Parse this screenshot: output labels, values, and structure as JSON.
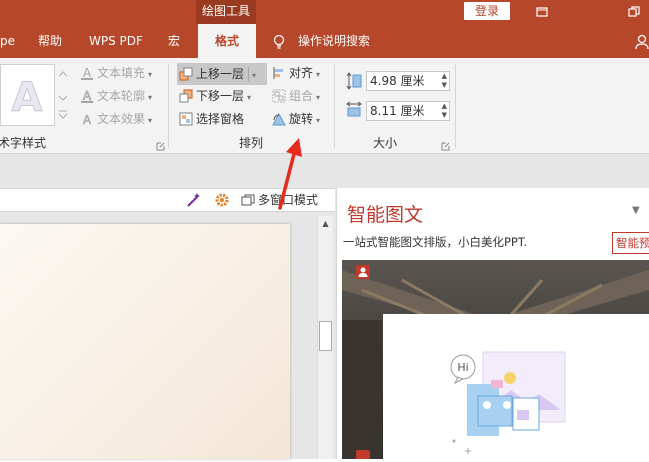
{
  "titlebar": {
    "context_label": "绘图工具",
    "login_label": "登录",
    "restore_icon": "restore-window-icon",
    "maximize_icon": "maximize-window-icon"
  },
  "tabs": [
    {
      "label": "pe"
    },
    {
      "label": "帮助"
    },
    {
      "label": "WPS PDF"
    },
    {
      "label": "宏"
    },
    {
      "label": "格式",
      "active": true
    },
    {
      "label": "操作说明搜索"
    }
  ],
  "ribbon": {
    "art_group": {
      "label": "艺术字样式",
      "fill": "文本填充",
      "outline": "文本轮廓",
      "effect": "文本效果"
    },
    "arrange_group": {
      "label": "排列",
      "bring_forward": "上移一层",
      "send_backward": "下移一层",
      "selection_pane": "选择窗格",
      "align": "对齐",
      "group": "组合",
      "rotate": "旋转"
    },
    "size_group": {
      "label": "大小",
      "height": "4.98 厘米",
      "width": "8.11 厘米"
    }
  },
  "workspace": {
    "multi_window": "多窗口模式"
  },
  "smart_pane": {
    "title": "智能图文",
    "subtitle": "一站式智能图文排版，小白美化PPT.",
    "button": "智能预",
    "bubble": "Hi"
  },
  "colors": {
    "accent": "#b7472a",
    "annotation_arrow": "#e52a1e"
  }
}
